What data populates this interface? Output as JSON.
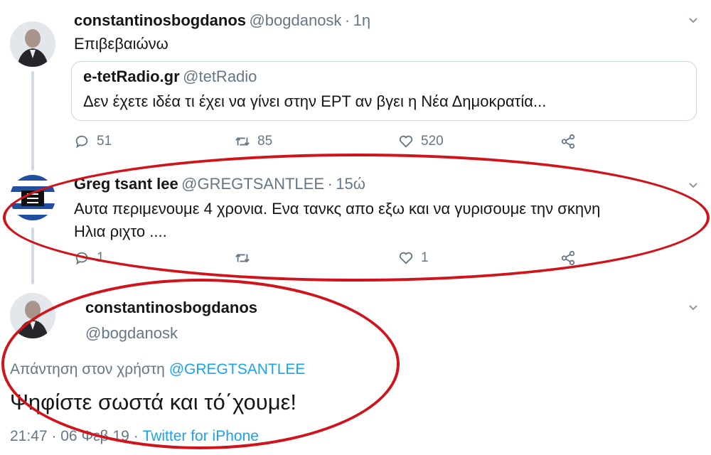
{
  "tweet1": {
    "name": "constantinosbogdanos",
    "handle": "@bogdanosk",
    "sep": "·",
    "time": "1η",
    "text": "Επιβεβαιώνω",
    "quote": {
      "name": "e-tetRadio.gr",
      "handle": "@tetRadio",
      "text": "Δεν έχετε ιδέα τι έχει να γίνει στην ΕΡΤ αν βγει η Νέα Δημοκρατία..."
    },
    "replies": "51",
    "retweets": "85",
    "likes": "520"
  },
  "tweet2": {
    "name": "Greg tsant lee",
    "handle": "@GREGTSANTLEE",
    "sep": "·",
    "time": "15ώ",
    "text_line1": "Αυτα περιμενουμε 4 χρονια. Ενα τανκς απο εξω και να γυρισουμε την σκηνη",
    "text_line2": "Ηλια ριχτο ....",
    "replies": "1",
    "retweets": "",
    "likes": "1"
  },
  "tweet3": {
    "name": "constantinosbogdanos",
    "handle": "@bogdanosk",
    "reply_prefix": "Απάντηση στον χρήστη",
    "reply_to": "@GREGTSANTLEE",
    "text": "Ψηφίστε σωστά και τό΄χουμε!",
    "time": "21:47",
    "sep1": "·",
    "date": "06 Φεβ 19",
    "sep2": "·",
    "source": "Twitter for iPhone"
  },
  "colors": {
    "annotation_red": "#d0141c",
    "link_blue": "#1da1f2",
    "muted": "#657786"
  },
  "icons": [
    "reply-icon",
    "retweet-icon",
    "like-icon",
    "share-icon",
    "chevron-down-icon"
  ]
}
